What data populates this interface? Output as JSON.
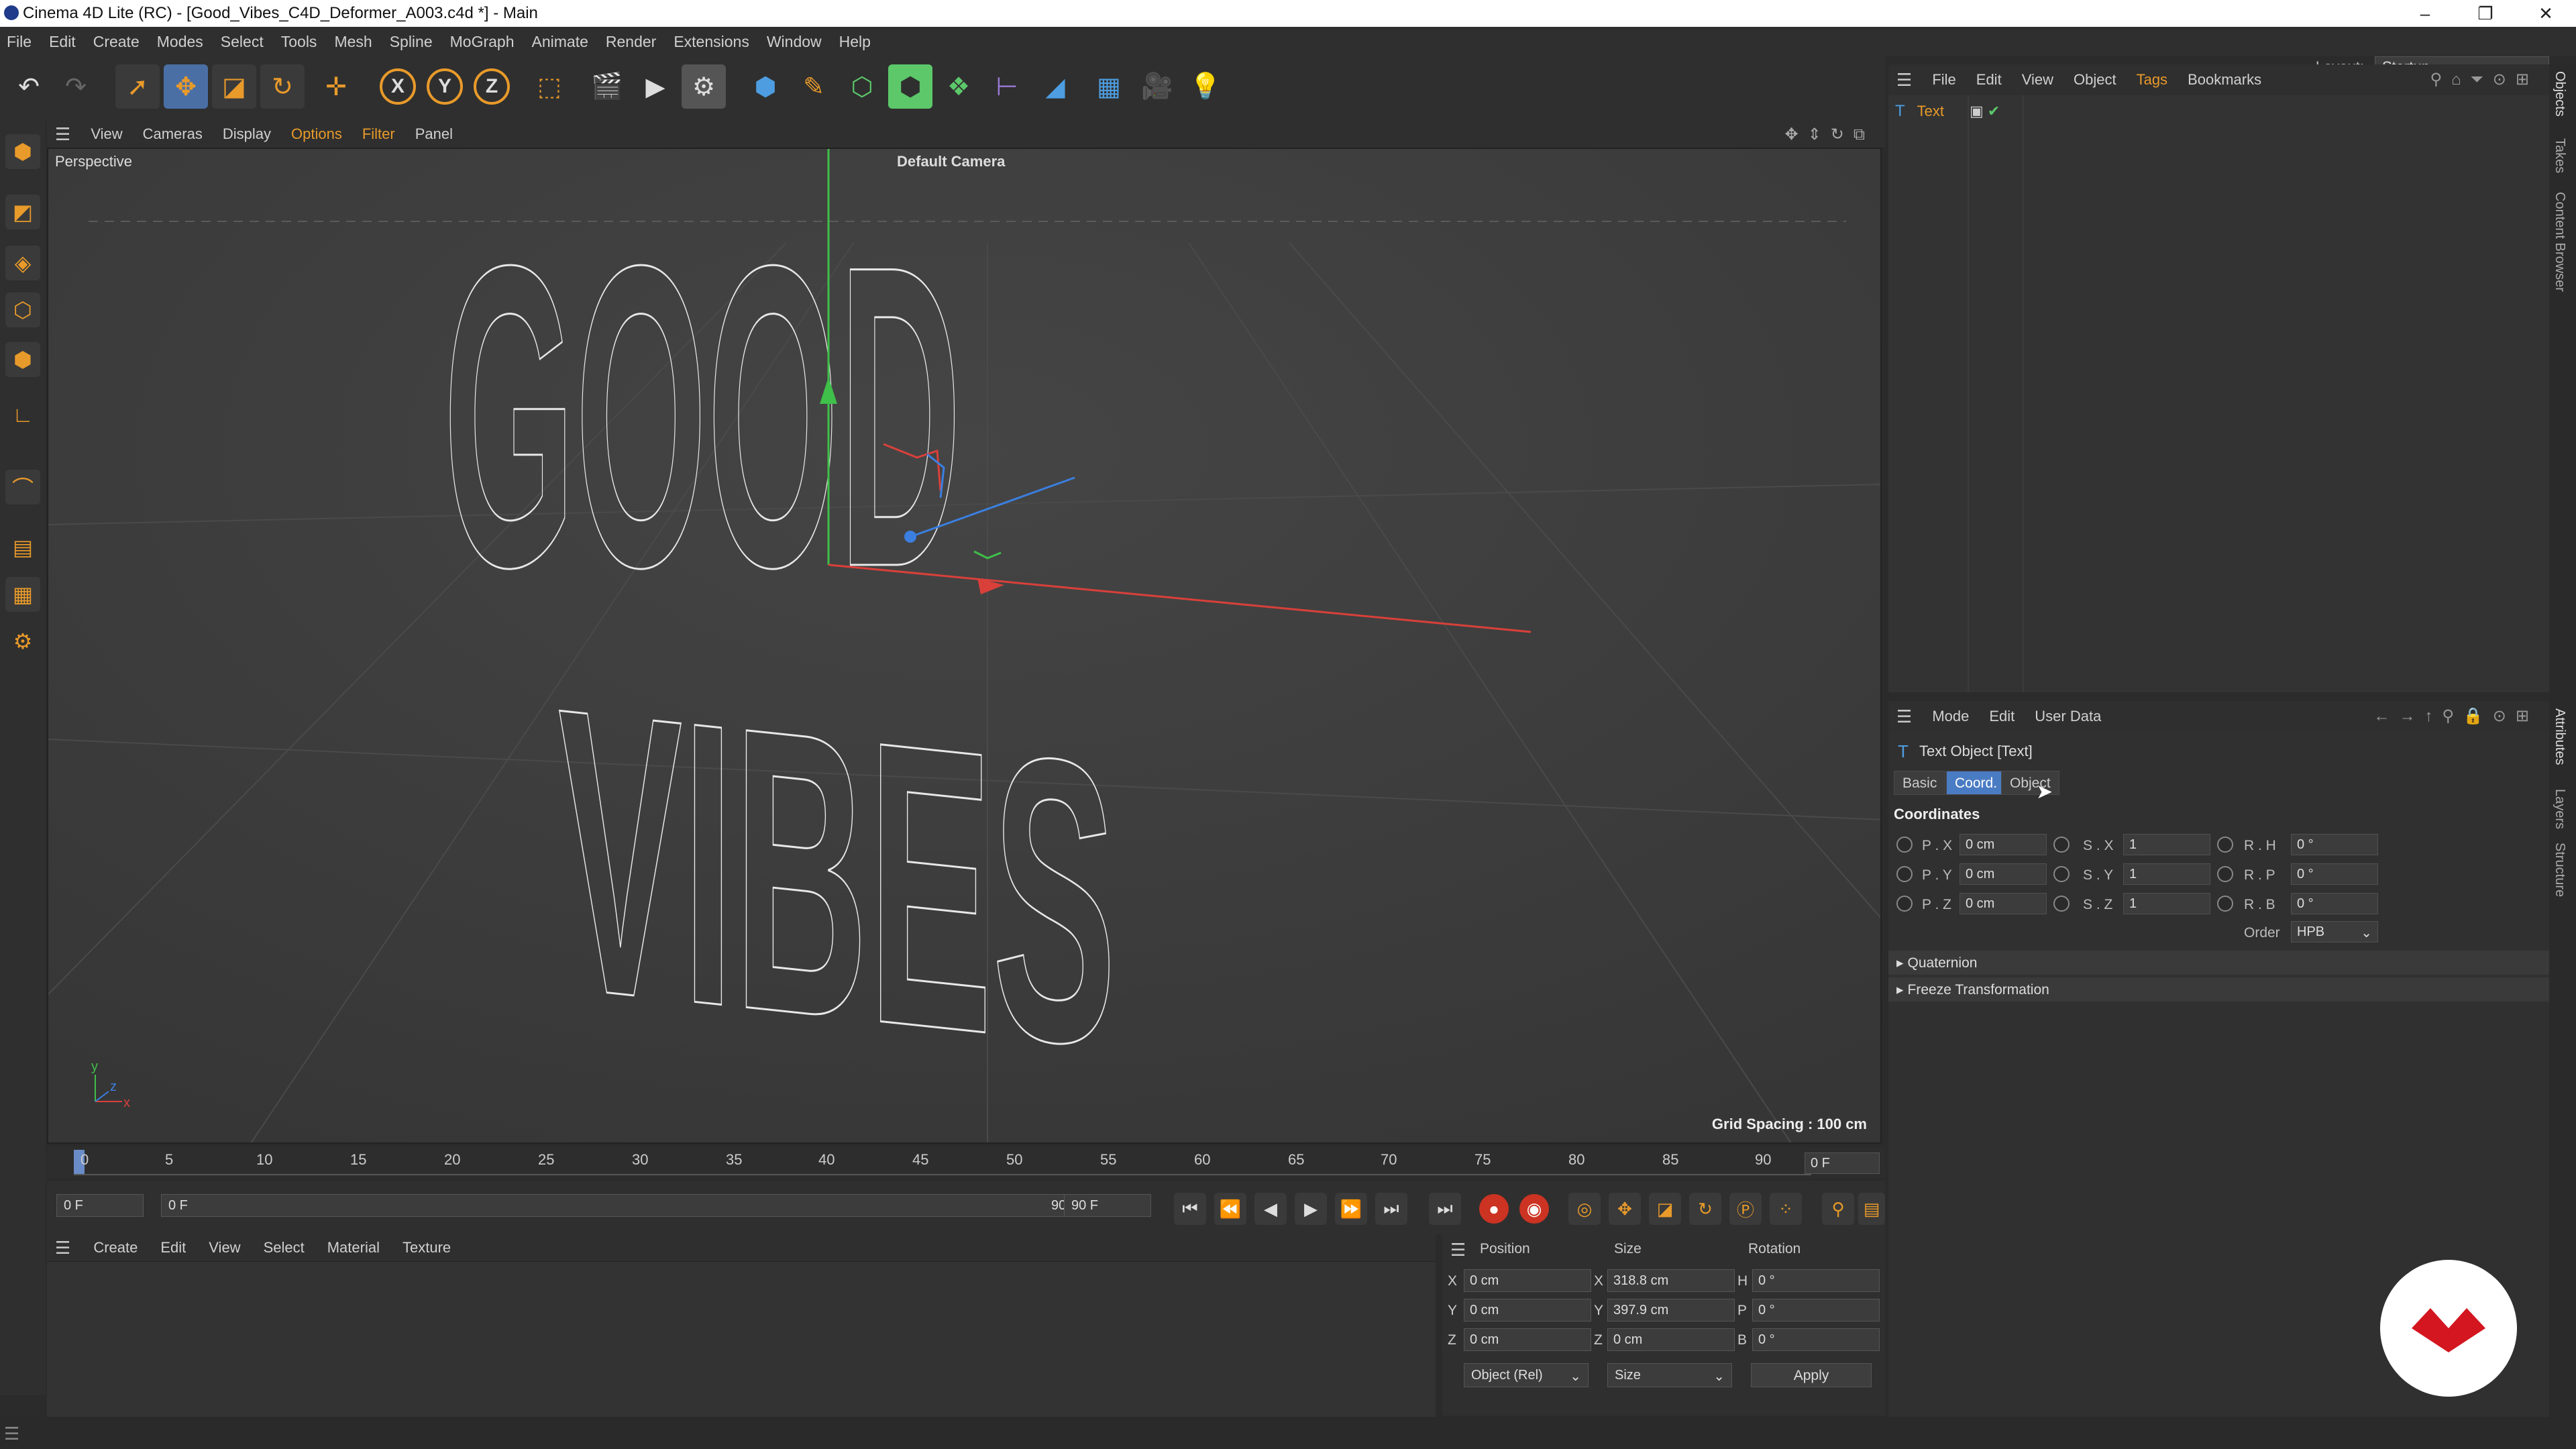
{
  "window": {
    "title": "Cinema 4D Lite (RC) - [Good_Vibes_C4D_Deformer_A003.c4d *] - Main",
    "controls": [
      "–",
      "❐",
      "✕"
    ]
  },
  "menu": [
    "File",
    "Edit",
    "Create",
    "Modes",
    "Select",
    "Tools",
    "Mesh",
    "Spline",
    "MoGraph",
    "Animate",
    "Render",
    "Extensions",
    "Window",
    "Help"
  ],
  "layout": {
    "label": "Layout:",
    "value": "Startup"
  },
  "toolbar_icons": [
    "undo-icon",
    "redo-icon",
    "live-selection-icon",
    "move-icon",
    "scale-icon",
    "rotate-icon",
    "add-object-icon",
    "x-axis-lock-icon",
    "y-axis-lock-icon",
    "z-axis-lock-icon",
    "coordinate-system-icon",
    "render-view-icon",
    "render-picture-queue-icon",
    "render-settings-icon",
    "cube-icon",
    "pen-spline-icon",
    "subdivision-icon",
    "array-icon",
    "deformer-icon",
    "field-icon",
    "environment-icon",
    "camera-icon",
    "light-icon"
  ],
  "toolbar_axes": [
    "X",
    "Y",
    "Z"
  ],
  "viewport": {
    "menu": [
      "View",
      "Cameras",
      "Display",
      "Options",
      "Filter",
      "Panel"
    ],
    "label": "Perspective",
    "camera": "Default Camera",
    "grid": "Grid Spacing : 100 cm",
    "text_line1": "GOOD",
    "text_line2": "VIBES"
  },
  "timeline": {
    "ticks": [
      "0",
      "5",
      "10",
      "15",
      "20",
      "25",
      "30",
      "35",
      "40",
      "45",
      "50",
      "55",
      "60",
      "65",
      "70",
      "75",
      "80",
      "85",
      "90"
    ],
    "current_frame": "0 F",
    "start": "0 F",
    "range_start": "0 F",
    "range_end": "90 F",
    "end": "90 F"
  },
  "material_manager": {
    "menu": [
      "Create",
      "Edit",
      "View",
      "Select",
      "Material",
      "Texture"
    ]
  },
  "coord_manager": {
    "headers": [
      "Position",
      "Size",
      "Rotation"
    ],
    "rows": [
      {
        "axis": "X",
        "pos": "0 cm",
        "size_axis": "X",
        "size": "318.8 cm",
        "rot_axis": "H",
        "rot": "0 °"
      },
      {
        "axis": "Y",
        "pos": "0 cm",
        "size_axis": "Y",
        "size": "397.9 cm",
        "rot_axis": "P",
        "rot": "0 °"
      },
      {
        "axis": "Z",
        "pos": "0 cm",
        "size_axis": "Z",
        "size": "0 cm",
        "rot_axis": "B",
        "rot": "0 °"
      }
    ],
    "mode": "Object (Rel)",
    "size_mode": "Size",
    "apply": "Apply"
  },
  "object_manager": {
    "menu": [
      "File",
      "Edit",
      "View",
      "Object",
      "Tags",
      "Bookmarks"
    ],
    "objects": [
      {
        "name": "Text"
      }
    ]
  },
  "attributes": {
    "menu": [
      "Mode",
      "Edit",
      "User Data"
    ],
    "object_title": "Text Object [Text]",
    "tabs": [
      "Basic",
      "Coord.",
      "Object"
    ],
    "active_tab": "Coord.",
    "section": "Coordinates",
    "rows": [
      {
        "p": "P . X",
        "pv": "0 cm",
        "s": "S . X",
        "sv": "1",
        "r": "R . H",
        "rv": "0 °"
      },
      {
        "p": "P . Y",
        "pv": "0 cm",
        "s": "S . Y",
        "sv": "1",
        "r": "R . P",
        "rv": "0 °"
      },
      {
        "p": "P . Z",
        "pv": "0 cm",
        "s": "S . Z",
        "sv": "1",
        "r": "R . B",
        "rv": "0 °"
      }
    ],
    "order_label": "Order",
    "order_value": "HPB",
    "collapsed": [
      "Quaternion",
      "Freeze Transformation"
    ]
  },
  "right_tabs_top": [
    "Objects",
    "Takes",
    "Content Browser"
  ],
  "right_tabs_bottom": [
    "Attributes",
    "Layers",
    "Structure"
  ],
  "colors": {
    "accent": "#e89a2a",
    "active_tab": "#4a7cc4",
    "axis_x": "#d9403a",
    "axis_y": "#3fc04a",
    "axis_z": "#3b7fe0"
  }
}
